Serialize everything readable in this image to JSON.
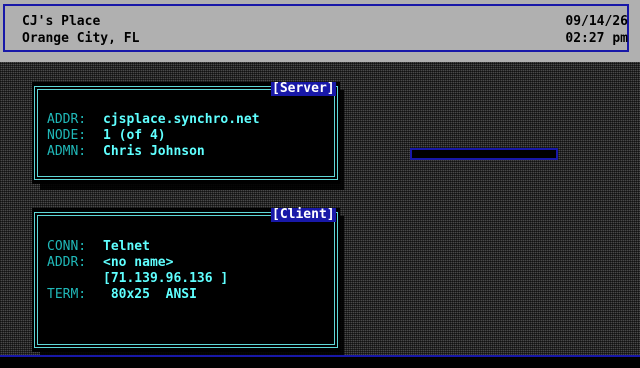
{
  "header": {
    "bbs_name": "CJ's Place",
    "location": "Orange City, FL",
    "date": "09/14/26",
    "time": "02:27 pm"
  },
  "server_panel": {
    "title": "[Server]",
    "rows": [
      {
        "label": "ADDR:",
        "value": "cjsplace.synchro.net"
      },
      {
        "label": "NODE:",
        "value": "1 (of 4)"
      },
      {
        "label": "ADMN:",
        "value": "Chris Johnson"
      }
    ]
  },
  "client_panel": {
    "title": "[Client]",
    "rows": [
      {
        "label": "CONN:",
        "value": "Telnet"
      },
      {
        "label": "ADDR:",
        "value": "<no name>"
      },
      {
        "label": "",
        "value": "[71.139.96.136 ]"
      },
      {
        "label": "TERM:",
        "value": " 80x25  ANSI"
      }
    ]
  },
  "colors": {
    "header_bg": "#b0b0b0",
    "accent_blue": "#1818a8",
    "panel_border": "#5fd7d7",
    "label": "#20b8b8",
    "value": "#5fffff"
  }
}
